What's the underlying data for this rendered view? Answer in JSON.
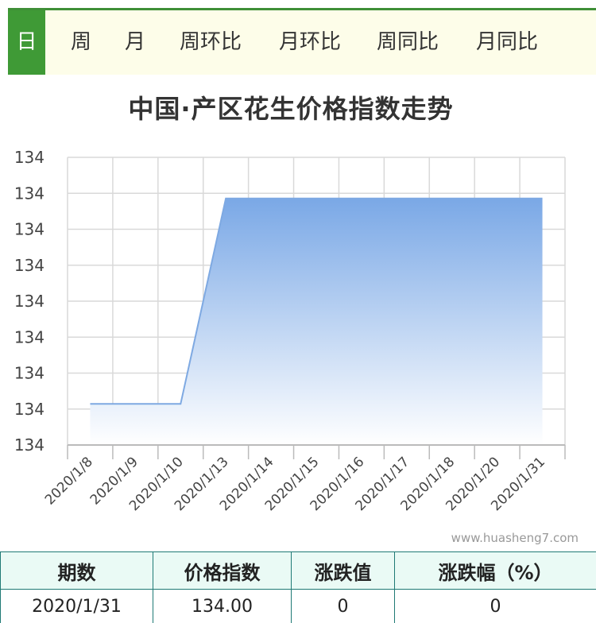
{
  "tabs": [
    {
      "label": "日",
      "active": true
    },
    {
      "label": "周",
      "active": false
    },
    {
      "label": "月",
      "active": false
    },
    {
      "label": "周环比",
      "active": false
    },
    {
      "label": "月环比",
      "active": false
    },
    {
      "label": "周同比",
      "active": false
    },
    {
      "label": "月同比",
      "active": false
    }
  ],
  "colors": {
    "tab_accent": "#3f9a36",
    "tab_background": "#fdfde9",
    "series_line": "#7ea9e2",
    "area_top": "#7aa8e6",
    "grid": "#d9d9d9",
    "table_border": "#1f7a75",
    "table_header_bg": "#eafaf5"
  },
  "watermark": "www.huasheng7.com",
  "chart_data": {
    "type": "area",
    "title": "中国·产区花生价格指数走势",
    "categories": [
      "2020/1/8",
      "2020/1/9",
      "2020/1/10",
      "2020/1/13",
      "2020/1/14",
      "2020/1/15",
      "2020/1/16",
      "2020/1/17",
      "2020/1/18",
      "2020/1/20",
      "2020/1/31"
    ],
    "series": [
      {
        "values": [
          133.99,
          133.99,
          133.99,
          134.01,
          134.01,
          134.01,
          134.01,
          134.01,
          134.01,
          134.01,
          134.01
        ]
      }
    ],
    "y_tick_labels": [
      "134",
      "134",
      "134",
      "134",
      "134",
      "134",
      "134",
      "134",
      "134"
    ],
    "ylim": [
      133.986,
      134.014
    ],
    "grid": true,
    "legend": "none"
  },
  "table": {
    "headers": [
      "期数",
      "价格指数",
      "涨跌值",
      "涨跌幅（%）"
    ],
    "rows": [
      [
        "2020/1/31",
        "134.00",
        "0",
        "0"
      ]
    ]
  }
}
